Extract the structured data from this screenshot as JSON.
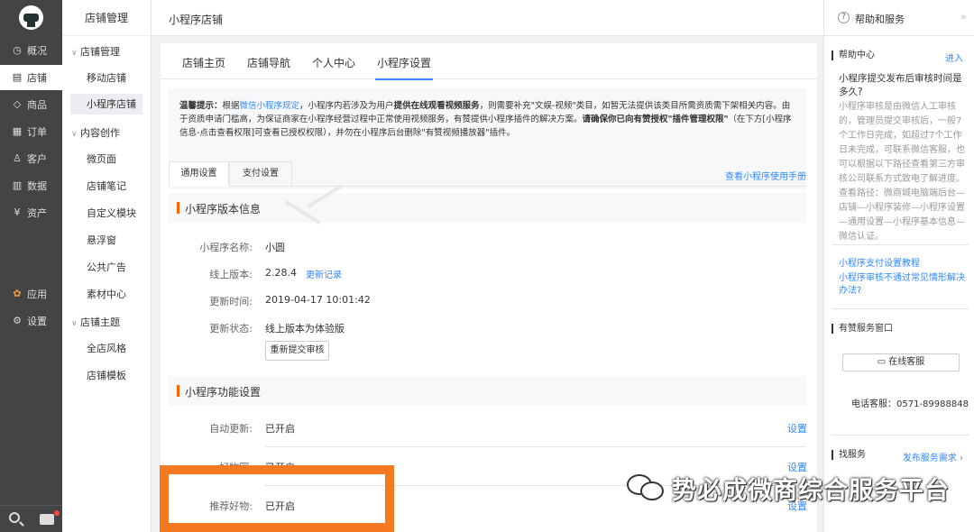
{
  "nav1": {
    "items": [
      {
        "label": "概况",
        "icon": "dashboard-icon"
      },
      {
        "label": "店铺",
        "icon": "store-icon"
      },
      {
        "label": "商品",
        "icon": "tag-icon"
      },
      {
        "label": "订单",
        "icon": "order-icon"
      },
      {
        "label": "客户",
        "icon": "user-icon"
      },
      {
        "label": "数据",
        "icon": "chart-icon"
      },
      {
        "label": "资产",
        "icon": "yuan-icon"
      },
      {
        "label": "应用",
        "icon": "apps-icon"
      },
      {
        "label": "设置",
        "icon": "gear-icon"
      }
    ],
    "active": "店铺"
  },
  "nav2": {
    "title": "店铺管理",
    "groups": [
      {
        "label": "店铺管理",
        "items": [
          "移动店铺",
          "小程序店铺"
        ]
      },
      {
        "label": "内容创作",
        "items": [
          "微页面",
          "店铺笔记",
          "自定义模块",
          "悬浮窗",
          "公共广告",
          "素材中心"
        ]
      },
      {
        "label": "店铺主题",
        "items": [
          "全店风格",
          "店铺模板"
        ]
      }
    ],
    "active": "小程序店铺"
  },
  "breadcrumb": "小程序店铺",
  "tabs": [
    "店铺主页",
    "店铺导航",
    "个人中心",
    "小程序设置"
  ],
  "active_tab": "小程序设置",
  "notice": {
    "prefix": "温馨提示：",
    "t1": "根据",
    "link": "微信小程序规定",
    "t2": "，小程序内若涉及为用户",
    "b1": "提供在线观看视频服务",
    "t3": "，则需要补充\"文娱-视频\"类目，如暂无法提供该类目所需资质需下架相关内容。由于资质申请门槛高，为保证商家在小程序经营过程中正常使用视频服务，有赞提供小程序插件的解决方案。",
    "b2": "请确保你已向有赞授权\"插件管理权限\"",
    "t4": "（在下方[小程序信息-点击查看权限]可查看已授权权限），并勿在小程序后台删除\"有赞视频播放器\"插件。"
  },
  "subtabs": [
    "通用设置",
    "支付设置"
  ],
  "manual_link": "查看小程序使用手册",
  "version_section": {
    "title": "小程序版本信息",
    "name_label": "小程序名称:",
    "name_value": "小圆",
    "online_label": "线上版本:",
    "online_value": "2.28.4",
    "changelog_link": "更新记录",
    "updated_label": "更新时间:",
    "updated_value": "2019-04-17 10:01:42",
    "status_label": "更新状态:",
    "status_value": "线上版本为体验版",
    "resubmit_button": "重新提交审核"
  },
  "feature_section": {
    "title": "小程序功能设置",
    "rows": [
      {
        "label": "自动更新:",
        "value": "已开启",
        "action": "设置"
      },
      {
        "label": "好物圈:",
        "value": "已开启",
        "action": "设置"
      },
      {
        "label": "推荐好物:",
        "value": "已开启",
        "action": "设置"
      }
    ]
  },
  "help": {
    "title": "帮助和服务",
    "center_title": "帮助中心",
    "enter_link": "进入",
    "question": "小程序提交发布后审核时间是多久?",
    "answer": "小程序审核是由微信人工审核的，管理员提交审核后，一般7个工作日完成，如超过7个工作日未完成，可联系微信客服，也可以根据以下路径查看第三方审核公司联系方式致电了解进度。查看路径：微商城电脑端后台—店铺—小程序装修—小程序设置—通用设置—小程序基本信息—微信认证。",
    "link1": "小程序支付设置教程",
    "link2": "小程序审核不通过常见情形解决办法?",
    "service_title": "有赞服务窗口",
    "online_service_button": "在线客服",
    "phone": "电话客服：0571-89988848",
    "find_service": "找服务",
    "post_demand": "发布服务需求 ›"
  },
  "watermark": "势必成微商综合服务平台",
  "colors": {
    "accent": "#3388ff",
    "highlight_box": "#f47920",
    "section_bar": "#ff6600",
    "nav_dark": "#444444"
  }
}
